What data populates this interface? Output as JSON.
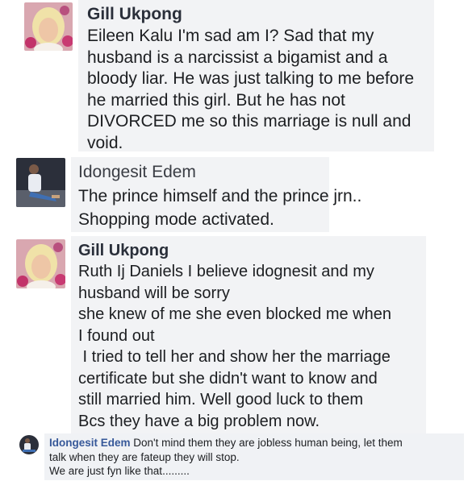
{
  "comments": [
    {
      "author": "Gill Ukpong",
      "lines": [
        "Eileen Kalu  I'm sad am I? Sad that my",
        "husband is a narcissist a bigamist and a",
        "bloody liar.  He was just talking to me before",
        "he married this girl.  But he has not",
        "DIVORCED me so this marriage is null and",
        "void."
      ]
    },
    {
      "author": "Idongesit Edem",
      "lines": [
        "The prince himself and the prince jrn..",
        "Shopping mode activated."
      ]
    },
    {
      "author": "Gill Ukpong",
      "lines": [
        "Ruth Ij Daniels I believe idognesit and my",
        "husband will be sorry",
        "she knew of me she even blocked me when",
        "I found out",
        " I tried to tell her and show her the marriage",
        "certificate but she didn't want to know and",
        "still married him.  Well good luck to them",
        "Bcs they have a big problem now."
      ]
    },
    {
      "author": "Idongesit Edem",
      "first_line_text": "Don't mind them they are jobless human being, let them",
      "lines": [
        "talk when they are fateup they will stop.",
        "We are just fyn like that........."
      ]
    }
  ],
  "colors": {
    "bubble_bg": "#f2f3f5",
    "name_link": "#365899",
    "text": "#1c1e21"
  }
}
